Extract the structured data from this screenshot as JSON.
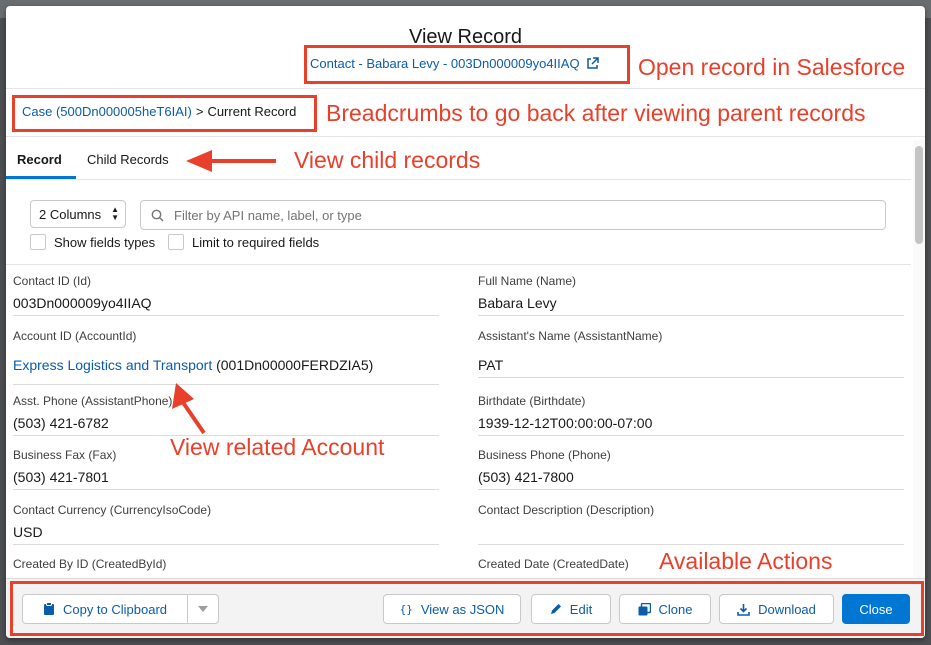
{
  "modal": {
    "title": "View Record",
    "record_link": "Contact - Babara Levy - 003Dn000009yo4IIAQ",
    "breadcrumb": {
      "parent": "Case (500Dn000005heT6IAI)",
      "separator": ">",
      "current": "Current Record"
    }
  },
  "tabs": [
    {
      "label": "Record",
      "active": true
    },
    {
      "label": "Child Records",
      "active": false
    }
  ],
  "toolbar": {
    "columns_select": "2 Columns",
    "filter_placeholder": "Filter by API name, label, or type",
    "show_field_types": "Show fields types",
    "limit_required": "Limit to required fields"
  },
  "fields": [
    {
      "label": "Contact ID (Id)",
      "value": "003Dn000009yo4IIAQ"
    },
    {
      "label": "Full Name (Name)",
      "value": "Babara Levy"
    },
    {
      "label": "Account ID (AccountId)",
      "link": "Express Logistics and Transport",
      "value": "(001Dn00000FERDZIA5)"
    },
    {
      "label": "Assistant's Name (AssistantName)",
      "value": "PAT"
    },
    {
      "label": "Asst. Phone (AssistantPhone)",
      "value": "(503) 421-6782"
    },
    {
      "label": "Birthdate (Birthdate)",
      "value": "1939-12-12T00:00:00-07:00"
    },
    {
      "label": "Business Fax (Fax)",
      "value": "(503) 421-7801"
    },
    {
      "label": "Business Phone (Phone)",
      "value": "(503) 421-7800"
    },
    {
      "label": "Contact Currency (CurrencyIsoCode)",
      "value": "USD"
    },
    {
      "label": "Contact Description (Description)",
      "value": ""
    },
    {
      "label": "Created By ID (CreatedById)",
      "value": ""
    },
    {
      "label": "Created Date (CreatedDate)",
      "value": ""
    }
  ],
  "footer": {
    "copy": "Copy to Clipboard",
    "json": "View as JSON",
    "edit": "Edit",
    "clone": "Clone",
    "download": "Download",
    "close": "Close"
  },
  "annotations": {
    "open_record": "Open record in Salesforce",
    "breadcrumbs": "Breadcrumbs to go back after viewing parent records",
    "child_records": "View child records",
    "related_account": "View related Account",
    "actions": "Available Actions"
  },
  "colors": {
    "annotation": "#e8402a",
    "link": "#0b5cab",
    "brand": "#0176d3"
  }
}
